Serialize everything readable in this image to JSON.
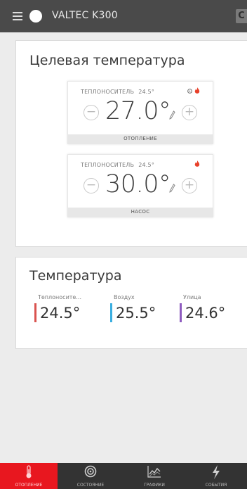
{
  "header": {
    "title": "VALTEC K300",
    "edge_label": "C"
  },
  "target_card": {
    "title": "Целевая температура",
    "thermostats": [
      {
        "sensor_label": "ТЕПЛОНОСИТЕЛЬ",
        "current": "24.5°",
        "value": "27.0°",
        "mode": "ОТОПЛЕНИЕ",
        "icons": [
          "gear-icon",
          "flame-icon"
        ]
      },
      {
        "sensor_label": "ТЕПЛОНОСИТЕЛЬ",
        "current": "24.5°",
        "value": "30.0°",
        "mode": "НАСОС",
        "icons": [
          "flame-icon"
        ]
      }
    ],
    "minus_symbol": "−",
    "plus_symbol": "+"
  },
  "temps_card": {
    "title": "Температура",
    "readings": [
      {
        "label": "Теплоносите...",
        "value": "24.5°",
        "color": "#d9534f"
      },
      {
        "label": "Воздух",
        "value": "25.5°",
        "color": "#3aaee0"
      },
      {
        "label": "Улица",
        "value": "24.6°",
        "color": "#8e5bbf"
      }
    ]
  },
  "bottom_nav": {
    "tabs": [
      {
        "label": "ОТОПЛЕНИЕ",
        "icon": "thermometer-icon",
        "active": true
      },
      {
        "label": "СОСТОЯНИЕ",
        "icon": "target-icon",
        "active": false
      },
      {
        "label": "ГРАФИКИ",
        "icon": "chart-icon",
        "active": false
      },
      {
        "label": "СОБЫТИЯ",
        "icon": "lightning-icon",
        "active": false
      }
    ]
  },
  "colors": {
    "header_bg": "#4a4a4a",
    "nav_bg": "#333333",
    "accent_red": "#e8171f",
    "flame": "#e8412a"
  }
}
